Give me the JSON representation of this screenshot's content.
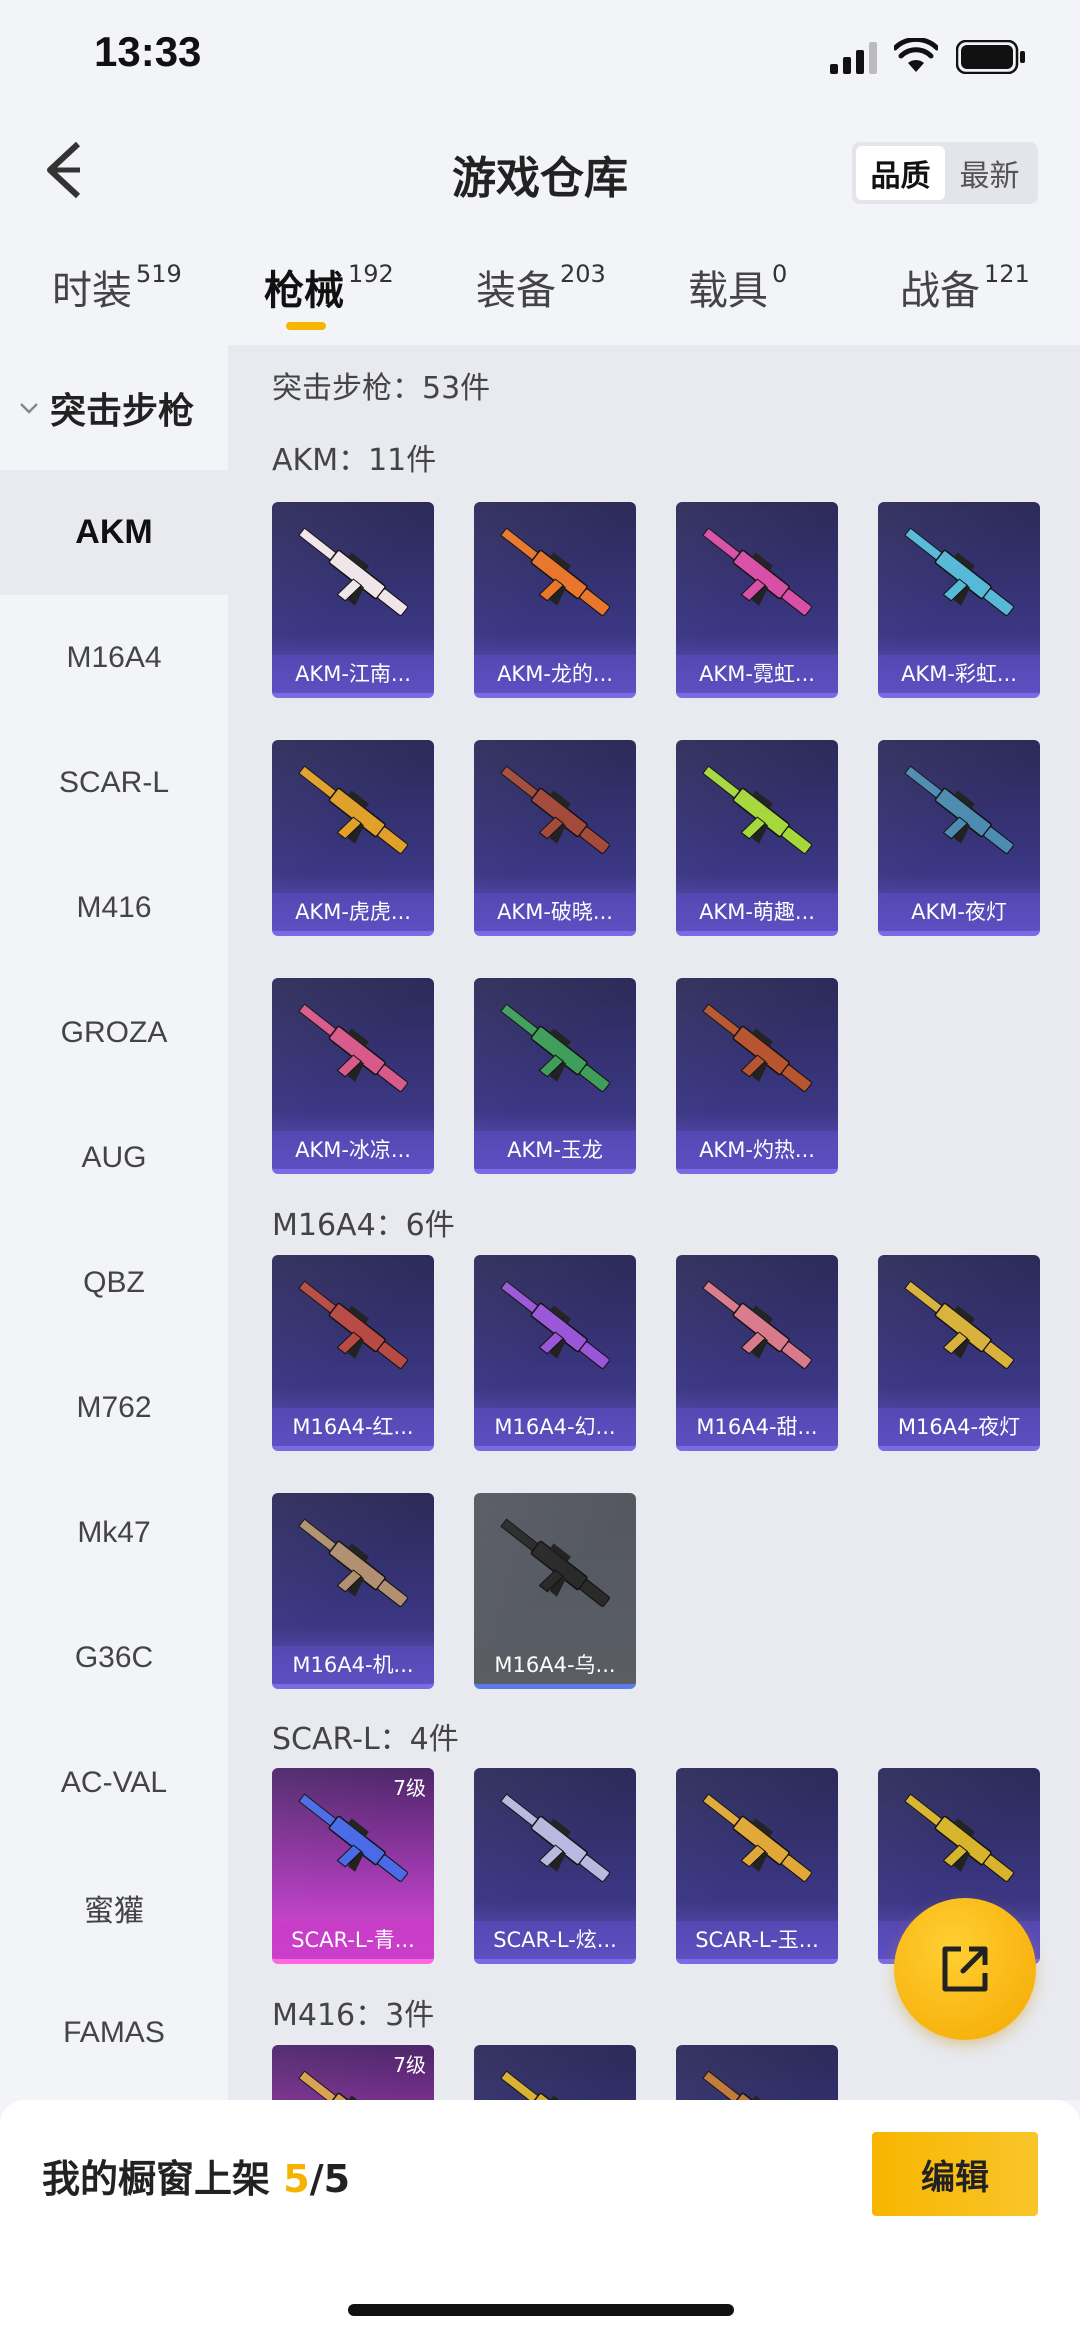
{
  "status": {
    "time": "13:33"
  },
  "header": {
    "title": "游戏仓库",
    "sort_quality": "品质",
    "sort_latest": "最新"
  },
  "tabs": [
    {
      "label": "时装",
      "count": "519"
    },
    {
      "label": "枪械",
      "count": "192"
    },
    {
      "label": "装备",
      "count": "203"
    },
    {
      "label": "载具",
      "count": "0"
    },
    {
      "label": "战备",
      "count": "121"
    }
  ],
  "sidebar": {
    "group": "突击步枪",
    "items": [
      "AKM",
      "M16A4",
      "SCAR-L",
      "M416",
      "GROZA",
      "AUG",
      "QBZ",
      "M762",
      "Mk47",
      "G36C",
      "AC-VAL",
      "蜜獾",
      "FAMAS"
    ]
  },
  "main": {
    "category_title": "突击步枪：53件",
    "sections": [
      {
        "title": "AKM：11件",
        "items": [
          {
            "name": "AKM-江南...",
            "tier": "purple",
            "color": "#f0e6ea"
          },
          {
            "name": "AKM-龙的...",
            "tier": "purple",
            "color": "#e8762b"
          },
          {
            "name": "AKM-霓虹...",
            "tier": "purple",
            "color": "#d94fa8"
          },
          {
            "name": "AKM-彩虹...",
            "tier": "purple",
            "color": "#56b9d8"
          },
          {
            "name": "AKM-虎虎...",
            "tier": "purple",
            "color": "#e0a02a"
          },
          {
            "name": "AKM-破晓...",
            "tier": "purple",
            "color": "#a44a3a"
          },
          {
            "name": "AKM-萌趣...",
            "tier": "purple",
            "color": "#a6d83c"
          },
          {
            "name": "AKM-夜灯",
            "tier": "purple",
            "color": "#4d8bb0"
          },
          {
            "name": "AKM-冰凉...",
            "tier": "purple",
            "color": "#d85a8a"
          },
          {
            "name": "AKM-玉龙",
            "tier": "purple",
            "color": "#3f9e5a"
          },
          {
            "name": "AKM-灼热...",
            "tier": "purple",
            "color": "#b8542f"
          }
        ]
      },
      {
        "title": "M16A4：6件",
        "items": [
          {
            "name": "M16A4-红...",
            "tier": "purple",
            "color": "#b84a44"
          },
          {
            "name": "M16A4-幻...",
            "tier": "purple",
            "color": "#9a56d8"
          },
          {
            "name": "M16A4-甜...",
            "tier": "purple",
            "color": "#d87a8c"
          },
          {
            "name": "M16A4-夜灯",
            "tier": "purple",
            "color": "#d8b23c"
          },
          {
            "name": "M16A4-机...",
            "tier": "purple",
            "color": "#b09070"
          },
          {
            "name": "M16A4-乌...",
            "tier": "grey",
            "color": "#2a2a2a"
          }
        ]
      },
      {
        "title": "SCAR-L：4件",
        "items": [
          {
            "name": "SCAR-L-青...",
            "tier": "pink",
            "level": "7级",
            "color": "#4a6ae8"
          },
          {
            "name": "SCAR-L-炫...",
            "tier": "purple",
            "color": "#b8b8e0"
          },
          {
            "name": "SCAR-L-玉...",
            "tier": "purple",
            "color": "#e0a838"
          },
          {
            "name": "SCAR-L-...",
            "tier": "purple",
            "color": "#d8b42c"
          }
        ]
      },
      {
        "title": "M416：3件",
        "items": [
          {
            "name": "",
            "tier": "pink",
            "level": "7级",
            "color": "#d8a050"
          },
          {
            "name": "",
            "tier": "purple",
            "color": "#d8b030"
          },
          {
            "name": "",
            "tier": "purple",
            "color": "#c07838"
          }
        ]
      }
    ]
  },
  "bottom": {
    "showcase_label": "我的橱窗上架",
    "showcase_current": "5",
    "showcase_total": "/5",
    "edit_label": "编辑"
  },
  "icons": {
    "back": "back-chevron-icon",
    "fab": "share-icon"
  }
}
